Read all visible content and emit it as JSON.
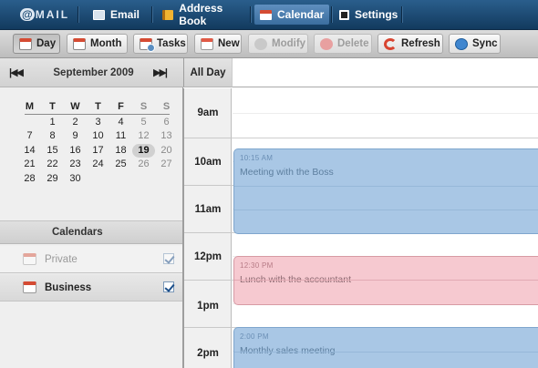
{
  "app": {
    "logo_at": "@",
    "logo_text": "MAIL"
  },
  "nav": {
    "tabs": [
      {
        "label": "Email",
        "icon": "email-icon"
      },
      {
        "label": "Address Book",
        "icon": "address-book-icon"
      },
      {
        "label": "Calendar",
        "icon": "calendar-icon",
        "active": true
      },
      {
        "label": "Settings",
        "icon": "settings-icon"
      }
    ]
  },
  "toolbar": {
    "day": "Day",
    "month": "Month",
    "tasks": "Tasks",
    "new": "New",
    "modify": "Modify",
    "delete": "Delete",
    "refresh": "Refresh",
    "sync": "Sync"
  },
  "mini_calendar": {
    "month_label": "September 2009",
    "prev_label": "|◀◀",
    "next_label": "▶▶|",
    "weekdays": [
      "M",
      "T",
      "W",
      "T",
      "F",
      "S",
      "S"
    ],
    "weeks": [
      [
        "",
        "1",
        "2",
        "3",
        "4",
        "5",
        "6"
      ],
      [
        "7",
        "8",
        "9",
        "10",
        "11",
        "12",
        "13"
      ],
      [
        "14",
        "15",
        "16",
        "17",
        "18",
        "19",
        "20"
      ],
      [
        "21",
        "22",
        "23",
        "24",
        "25",
        "26",
        "27"
      ],
      [
        "28",
        "29",
        "30",
        "",
        "",
        "",
        ""
      ]
    ],
    "selected_day": "19"
  },
  "calendars": {
    "header": "Calendars",
    "items": [
      {
        "label": "Private",
        "checked": true,
        "selected": false
      },
      {
        "label": "Business",
        "checked": true,
        "selected": true
      }
    ]
  },
  "day_view": {
    "all_day_label": "All Day",
    "hours": [
      "9am",
      "10am",
      "11am",
      "12pm",
      "1pm",
      "2pm"
    ],
    "events": [
      {
        "time": "10:15 AM",
        "title": "Meeting with the Boss",
        "color": "#a9c7e5"
      },
      {
        "time": "12:30 PM",
        "title": "Lunch with the accountant",
        "color": "#f6c9d0"
      },
      {
        "time": "2:00 PM",
        "title": "Monthly sales meeting",
        "color": "#a9c7e5"
      }
    ]
  },
  "colors": {
    "nav_bg": "#1d4a72",
    "event_blue": "#a9c7e5",
    "event_pink": "#f6c9d0",
    "accent_red": "#d54b33"
  }
}
